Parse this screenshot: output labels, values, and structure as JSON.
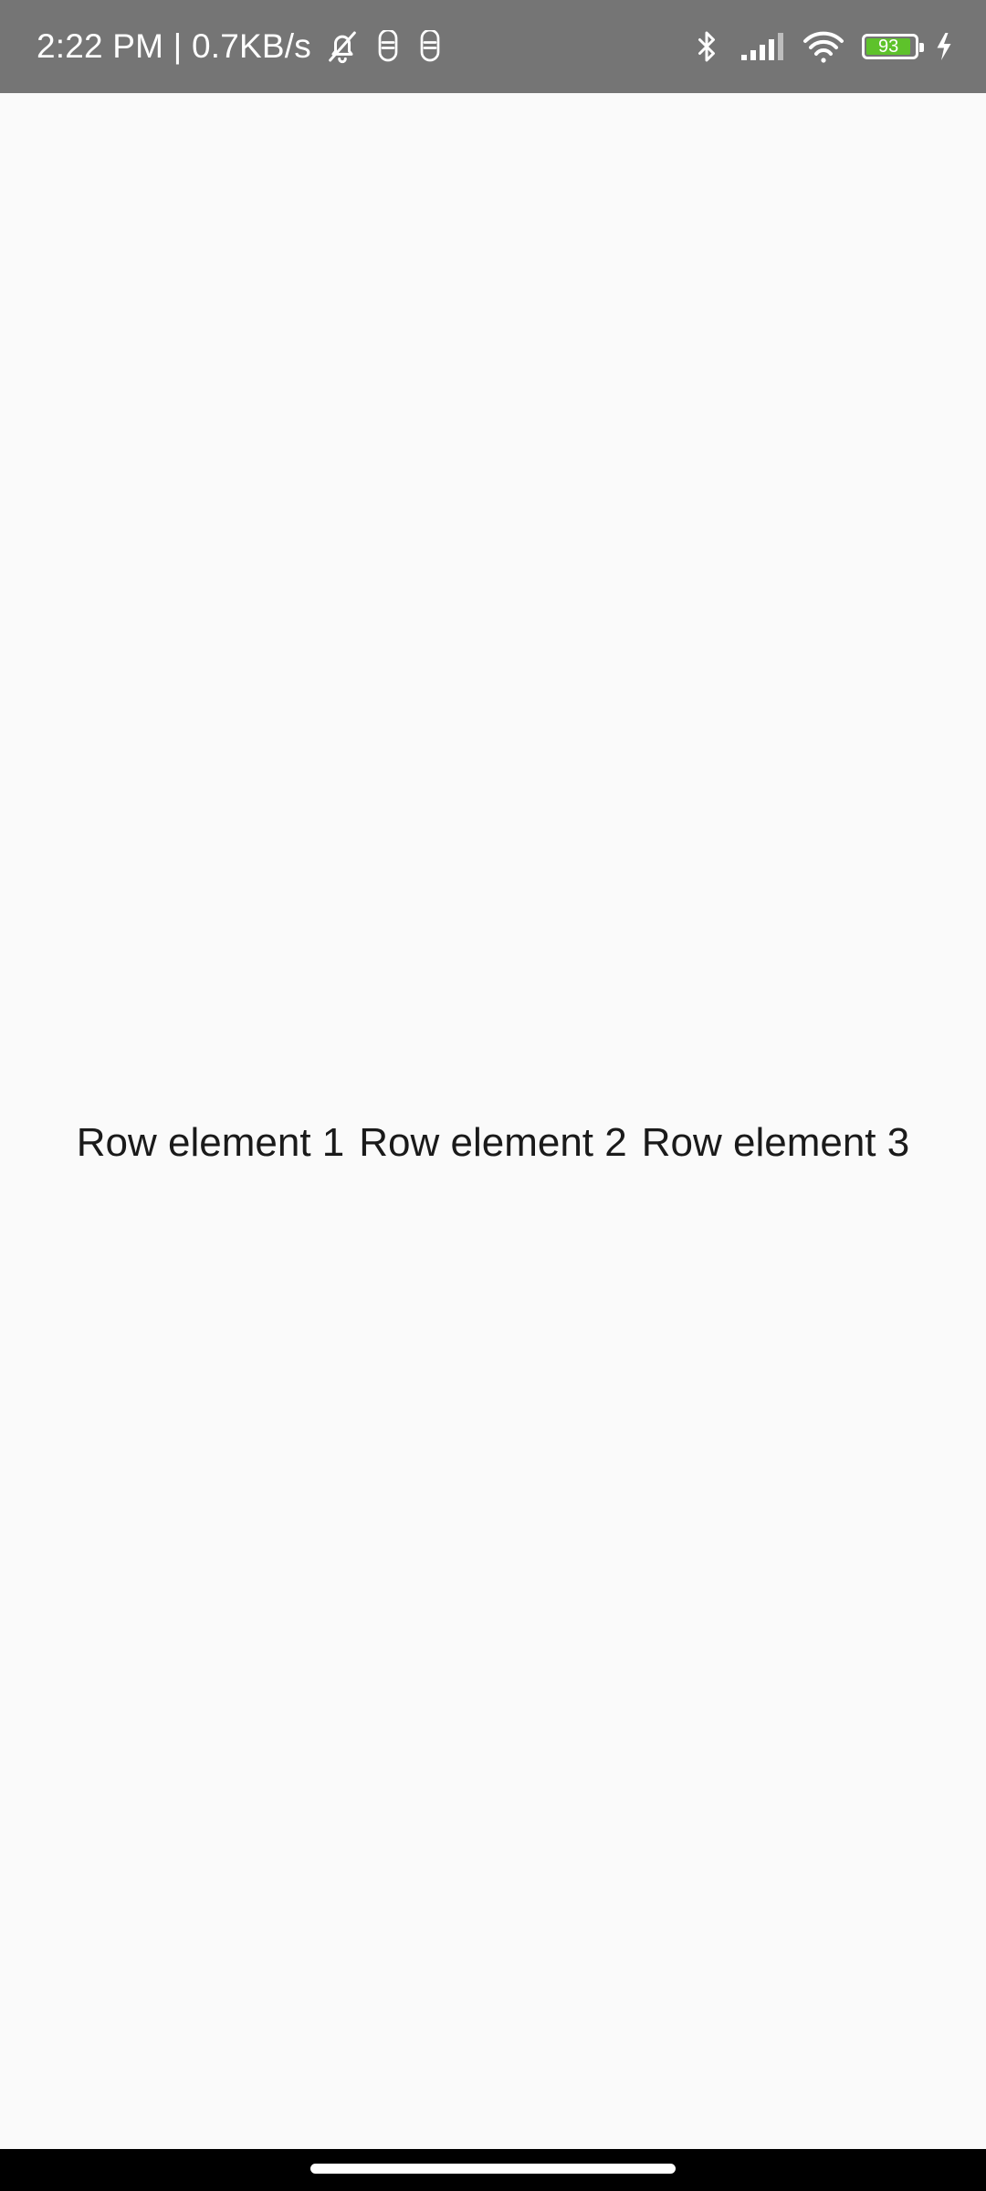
{
  "status_bar": {
    "time_text": "2:22 PM | 0.7KB/s",
    "battery_level": "93",
    "battery_percent": 93,
    "icons_left": [
      "bell-off-icon",
      "sim-icon",
      "sim-icon"
    ],
    "icons_right": [
      "bluetooth-icon",
      "signal-icon",
      "wifi-icon",
      "battery-icon",
      "charging-icon"
    ],
    "colors": {
      "background": "#757575",
      "battery_fill": "#5ec22b"
    }
  },
  "row": {
    "items": [
      {
        "label": "Row element 1"
      },
      {
        "label": "Row element 2"
      },
      {
        "label": "Row element 3"
      }
    ]
  },
  "colors": {
    "background": "#fafafa",
    "text": "#1a1a1a",
    "nav_bar": "#000000"
  }
}
